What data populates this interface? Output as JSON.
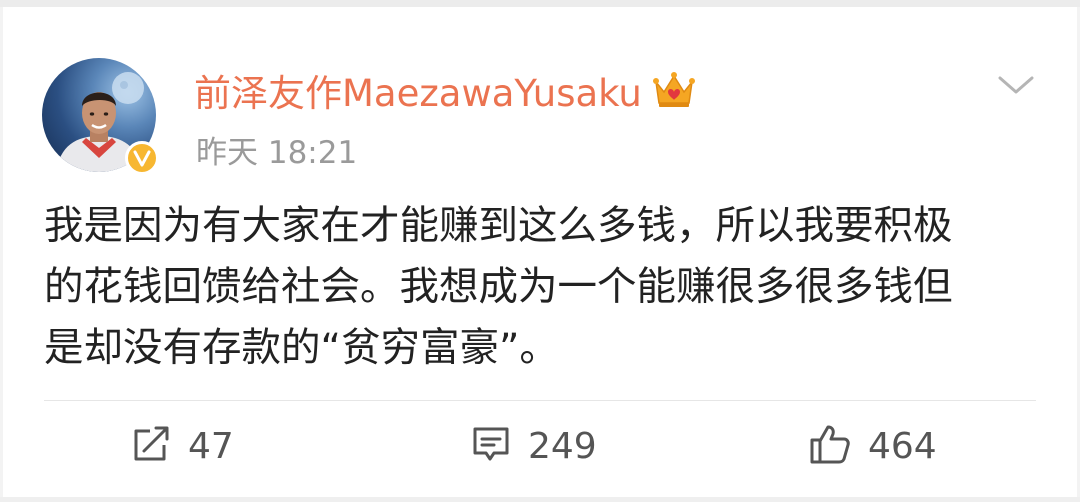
{
  "post": {
    "author": "前泽友作MaezawaYusaku",
    "timestamp": "昨天 18:21",
    "text_lines": [
      "我是因为有大家在才能赚到这么多钱，所以我要积极",
      "的花钱回馈给社会。我想成为一个能赚很多很多钱但",
      "是却没有存款的“贫穷富豪”。"
    ]
  },
  "icons": {
    "avatar": "user-avatar",
    "verified": "verified-badge-icon",
    "crown": "crown-icon",
    "menu": "chevron-down-icon",
    "repost": "repost-icon",
    "comment": "comment-icon",
    "like": "thumbs-up-icon"
  },
  "actions": {
    "repost_count": "47",
    "comment_count": "249",
    "like_count": "464"
  },
  "colors": {
    "author": "#eb7350",
    "verified": "#f7b731",
    "crown": "#f5a623",
    "text": "#222222",
    "meta": "#9a9a9a"
  }
}
